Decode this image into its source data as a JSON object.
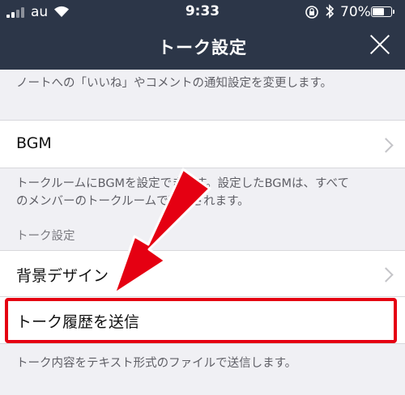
{
  "status_bar": {
    "carrier": "au",
    "time": "9:33",
    "battery_percent": "70%",
    "battery_level": 0.7
  },
  "nav": {
    "title": "トーク設定",
    "close_icon": "close-icon"
  },
  "content": {
    "note_desc": "ノートへの「いいね」やコメントの通知設定を変更します。",
    "bgm_label": "BGM",
    "bgm_desc_line1": "トークルームにBGMを設定できます。設定したBGMは、すべて",
    "bgm_desc_line2": "のメンバーのトークルームで再生されます。",
    "section_talk": "トーク設定",
    "background_label": "背景デザイン",
    "send_history_label": "トーク履歴を送信",
    "send_history_desc": "トーク内容をテキスト形式のファイルで送信します。"
  },
  "colors": {
    "nav_background": "#2c3648",
    "highlight_red": "#e50012",
    "page_background": "#f0f0f4"
  }
}
